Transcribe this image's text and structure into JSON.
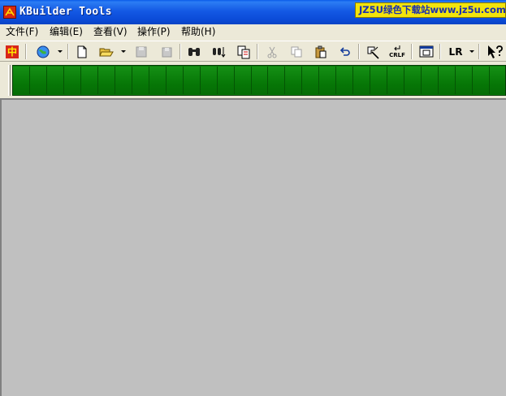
{
  "window": {
    "title": "KBuilder Tools",
    "watermark": "JZ5U绿色下载站www.jz5u.com"
  },
  "menu": [
    {
      "label": "文件(F)"
    },
    {
      "label": "编辑(E)"
    },
    {
      "label": "查看(V)"
    },
    {
      "label": "操作(P)"
    },
    {
      "label": "帮助(H)"
    }
  ],
  "toolbar": {
    "lang_label": "中",
    "crlf_label": "CRLF",
    "lr_label": "LR",
    "icons": [
      "language-icon",
      "globe-icon",
      "new-file-icon",
      "open-folder-icon",
      "save-icon",
      "save-all-icon",
      "find-icon",
      "find-next-icon",
      "replace-icon",
      "cut-icon",
      "copy-icon",
      "paste-icon",
      "undo-icon",
      "run-icon",
      "crlf-icon",
      "window-icon",
      "lr-icon",
      "context-help-icon"
    ]
  },
  "progress": {
    "segments": 29
  },
  "colors": {
    "titlebar": "#0b4bd8",
    "led_green": "#0a7a0a",
    "client_bg": "#c0c0c0",
    "watermark_bg": "#f2e40c"
  }
}
